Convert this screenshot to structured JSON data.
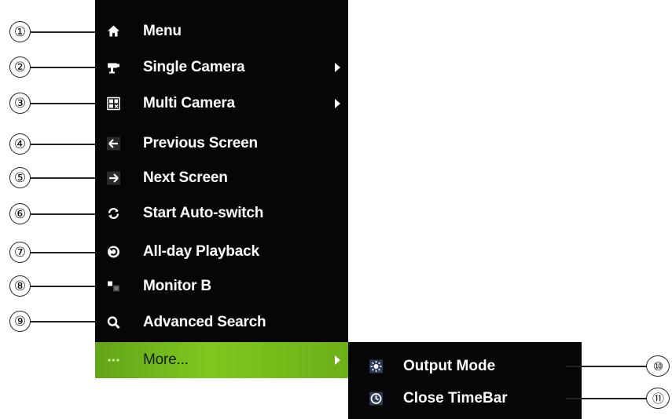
{
  "main_menu": {
    "items": [
      {
        "label": "Menu",
        "icon": "home-icon",
        "submenu": false
      },
      {
        "label": "Single Camera",
        "icon": "camera-icon",
        "submenu": true
      },
      {
        "label": "Multi Camera",
        "icon": "multi-camera-icon",
        "submenu": true
      },
      {
        "label": "Previous Screen",
        "icon": "arrow-left-icon",
        "submenu": false
      },
      {
        "label": "Next Screen",
        "icon": "arrow-right-icon",
        "submenu": false
      },
      {
        "label": "Start Auto-switch",
        "icon": "refresh-icon",
        "submenu": false
      },
      {
        "label": "All-day Playback",
        "icon": "playback-icon",
        "submenu": false
      },
      {
        "label": "Monitor B",
        "icon": "monitor-icon",
        "submenu": false
      },
      {
        "label": "Advanced Search",
        "icon": "search-icon",
        "submenu": false
      },
      {
        "label": "More...",
        "icon": "more-icon",
        "submenu": true,
        "highlighted": true
      }
    ]
  },
  "submenu": {
    "items": [
      {
        "label": "Output Mode",
        "icon": "output-mode-icon"
      },
      {
        "label": "Close TimeBar",
        "icon": "clock-icon"
      }
    ]
  },
  "callouts": [
    "①",
    "②",
    "③",
    "④",
    "⑤",
    "⑥",
    "⑦",
    "⑧",
    "⑨",
    "⑩",
    "⑪"
  ],
  "colors": {
    "panel": "#060606",
    "highlight": "#7ec81e",
    "text": "#ffffff"
  }
}
